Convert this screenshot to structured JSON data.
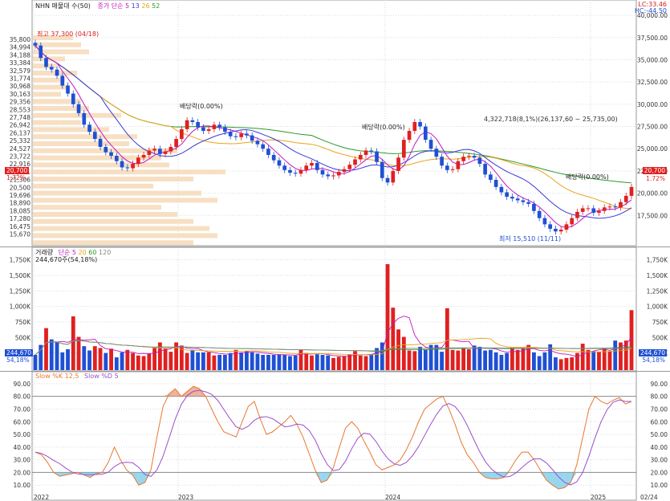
{
  "price_panel": {
    "legend": {
      "title": "NHN 매물대 수(50)",
      "ma_label": "종가 단순",
      "ma_periods": [
        "5",
        "13",
        "26",
        "52"
      ]
    },
    "lc_label": "LC:33.46",
    "hc_label": "HC:-44.50",
    "last_price_tag": "20,700",
    "last_change_tag": "1.72%",
    "left_price_tag": "20,700",
    "left_change_tag": "1.72%",
    "high_annotation": "최고 37,300 (04/18)",
    "low_annotation": "최저 15,510 (11/11)",
    "div_marks": [
      "배당락(0.00%)",
      "배당락(0.00%)",
      "배당락(0.00%)"
    ],
    "range_label": "4,322,718(8,1%)(26,137,60 ~ 25,735,00)"
  },
  "volume_panel": {
    "legend": {
      "title": "거래량",
      "ma_label": "단순",
      "ma_periods": [
        "5",
        "20",
        "60",
        "120"
      ]
    },
    "sub_legend": "244,670주(54,18%)",
    "last_tag": "244,670",
    "last_pct_tag": "54,18%"
  },
  "stoch_panel": {
    "legend": {
      "k": "Slow %K 12,5",
      "d": "Slow %D 5"
    }
  },
  "x_axis_labels": [
    "2022",
    "2023",
    "2024",
    "2025",
    "02/24"
  ],
  "chart_data": [
    {
      "type": "candlestick",
      "y_ticks": [
        17500,
        20000,
        22500,
        25000,
        27500,
        30000,
        32500,
        35000,
        37500,
        40000
      ],
      "ylim": [
        15000,
        41000
      ],
      "left_price_ticks": [
        "35,800",
        "34,994",
        "34,188",
        "33,384",
        "32,579",
        "31,774",
        "30,968",
        "30,163",
        "29,356",
        "28,553",
        "27,748",
        "26,942",
        "26,137",
        "25,332",
        "24,527",
        "23,722",
        "22,916",
        "22,111",
        "21,306",
        "20,500",
        "19,696",
        "18,890",
        "18,085",
        "17,280",
        "16,475",
        "15,670"
      ],
      "closes": [
        36600,
        35200,
        34200,
        33900,
        33200,
        32100,
        31200,
        30000,
        29000,
        27700,
        26900,
        26100,
        25200,
        24600,
        24200,
        23600,
        22900,
        22800,
        23300,
        24000,
        24300,
        24800,
        25000,
        24400,
        24700,
        25200,
        26100,
        27200,
        28200,
        28000,
        27400,
        27000,
        27200,
        27700,
        27400,
        26900,
        26400,
        26300,
        26700,
        26500,
        25900,
        25500,
        25000,
        24300,
        23700,
        23100,
        22600,
        22300,
        22200,
        22600,
        23100,
        23400,
        22600,
        22100,
        21900,
        22000,
        22400,
        22700,
        23200,
        23800,
        24300,
        24800,
        24700,
        23500,
        21700,
        21200,
        22500,
        24000,
        26000,
        27000,
        28000,
        27500,
        26000,
        25000,
        24100,
        23100,
        22600,
        22700,
        23600,
        24100,
        24200,
        24000,
        23300,
        22100,
        21500,
        20700,
        20100,
        19600,
        19400,
        19200,
        19000,
        18800,
        18000,
        17200,
        16500,
        16000,
        15700,
        15900,
        16500,
        17200,
        17900,
        18300,
        18300,
        17800,
        18000,
        18400,
        18500,
        18400,
        19000,
        19700,
        20700
      ],
      "volume_bars": [
        220,
        380,
        650,
        470,
        420,
        260,
        310,
        840,
        510,
        360,
        290,
        360,
        330,
        250,
        320,
        180,
        260,
        300,
        250,
        210,
        200,
        240,
        330,
        420,
        320,
        270,
        420,
        370,
        250,
        300,
        260,
        260,
        260,
        210,
        220,
        220,
        250,
        300,
        260,
        280,
        260,
        240,
        220,
        220,
        220,
        230,
        220,
        200,
        210,
        300,
        250,
        210,
        230,
        220,
        210,
        170,
        190,
        200,
        230,
        280,
        210,
        200,
        220,
        330,
        420,
        1680,
        980,
        630,
        510,
        290,
        280,
        350,
        300,
        380,
        380,
        270,
        970,
        300,
        290,
        320,
        310,
        370,
        350,
        290,
        300,
        260,
        220,
        250,
        340,
        300,
        320,
        380,
        260,
        200,
        260,
        390,
        180,
        150,
        170,
        180,
        250,
        400,
        300,
        280,
        270,
        320,
        280,
        450,
        420,
        450,
        940
      ],
      "volume_up": [
        0,
        0,
        1,
        0,
        0,
        0,
        0,
        1,
        1,
        0,
        0,
        1,
        1,
        0,
        1,
        0,
        0,
        1,
        1,
        1,
        1,
        1,
        1,
        1,
        1,
        1,
        1,
        1,
        1,
        0,
        0,
        0,
        1,
        1,
        0,
        0,
        0,
        1,
        0,
        0,
        0,
        0,
        0,
        0,
        0,
        0,
        0,
        0,
        0,
        1,
        1,
        1,
        0,
        0,
        0,
        1,
        1,
        1,
        1,
        1,
        1,
        1,
        0,
        0,
        0,
        1,
        1,
        1,
        1,
        1,
        1,
        0,
        0,
        0,
        0,
        0,
        1,
        1,
        1,
        1,
        1,
        0,
        0,
        0,
        0,
        0,
        0,
        0,
        1,
        1,
        1,
        1,
        0,
        0,
        0,
        0,
        0,
        1,
        1,
        1,
        1,
        1,
        1,
        0,
        1,
        1,
        1,
        0,
        1,
        1,
        1
      ],
      "volume_ticks": [
        "1,750K",
        "1,500K",
        "1,250K",
        "1,000K",
        "750K",
        "500K",
        "250K"
      ],
      "volume_ylim": [
        0,
        1900
      ],
      "stoch_ticks": [
        90,
        80,
        70,
        60,
        50,
        40,
        30,
        20,
        10
      ],
      "slow_k": [
        36,
        34,
        28,
        20,
        17,
        18,
        19,
        20,
        18,
        16,
        19,
        20,
        28,
        40,
        30,
        22,
        18,
        10,
        12,
        22,
        48,
        72,
        82,
        86,
        80,
        84,
        88,
        86,
        80,
        70,
        60,
        52,
        50,
        48,
        60,
        72,
        76,
        62,
        50,
        52,
        56,
        60,
        65,
        58,
        48,
        35,
        22,
        12,
        14,
        24,
        40,
        55,
        60,
        55,
        45,
        36,
        26,
        22,
        24,
        26,
        30,
        38,
        48,
        60,
        70,
        74,
        78,
        80,
        70,
        58,
        44,
        34,
        28,
        20,
        16,
        15,
        15,
        16,
        22,
        30,
        36,
        36,
        30,
        22,
        14,
        10,
        7,
        8,
        12,
        26,
        48,
        70,
        80,
        76,
        74,
        77,
        79,
        74,
        76
      ]
    }
  ]
}
